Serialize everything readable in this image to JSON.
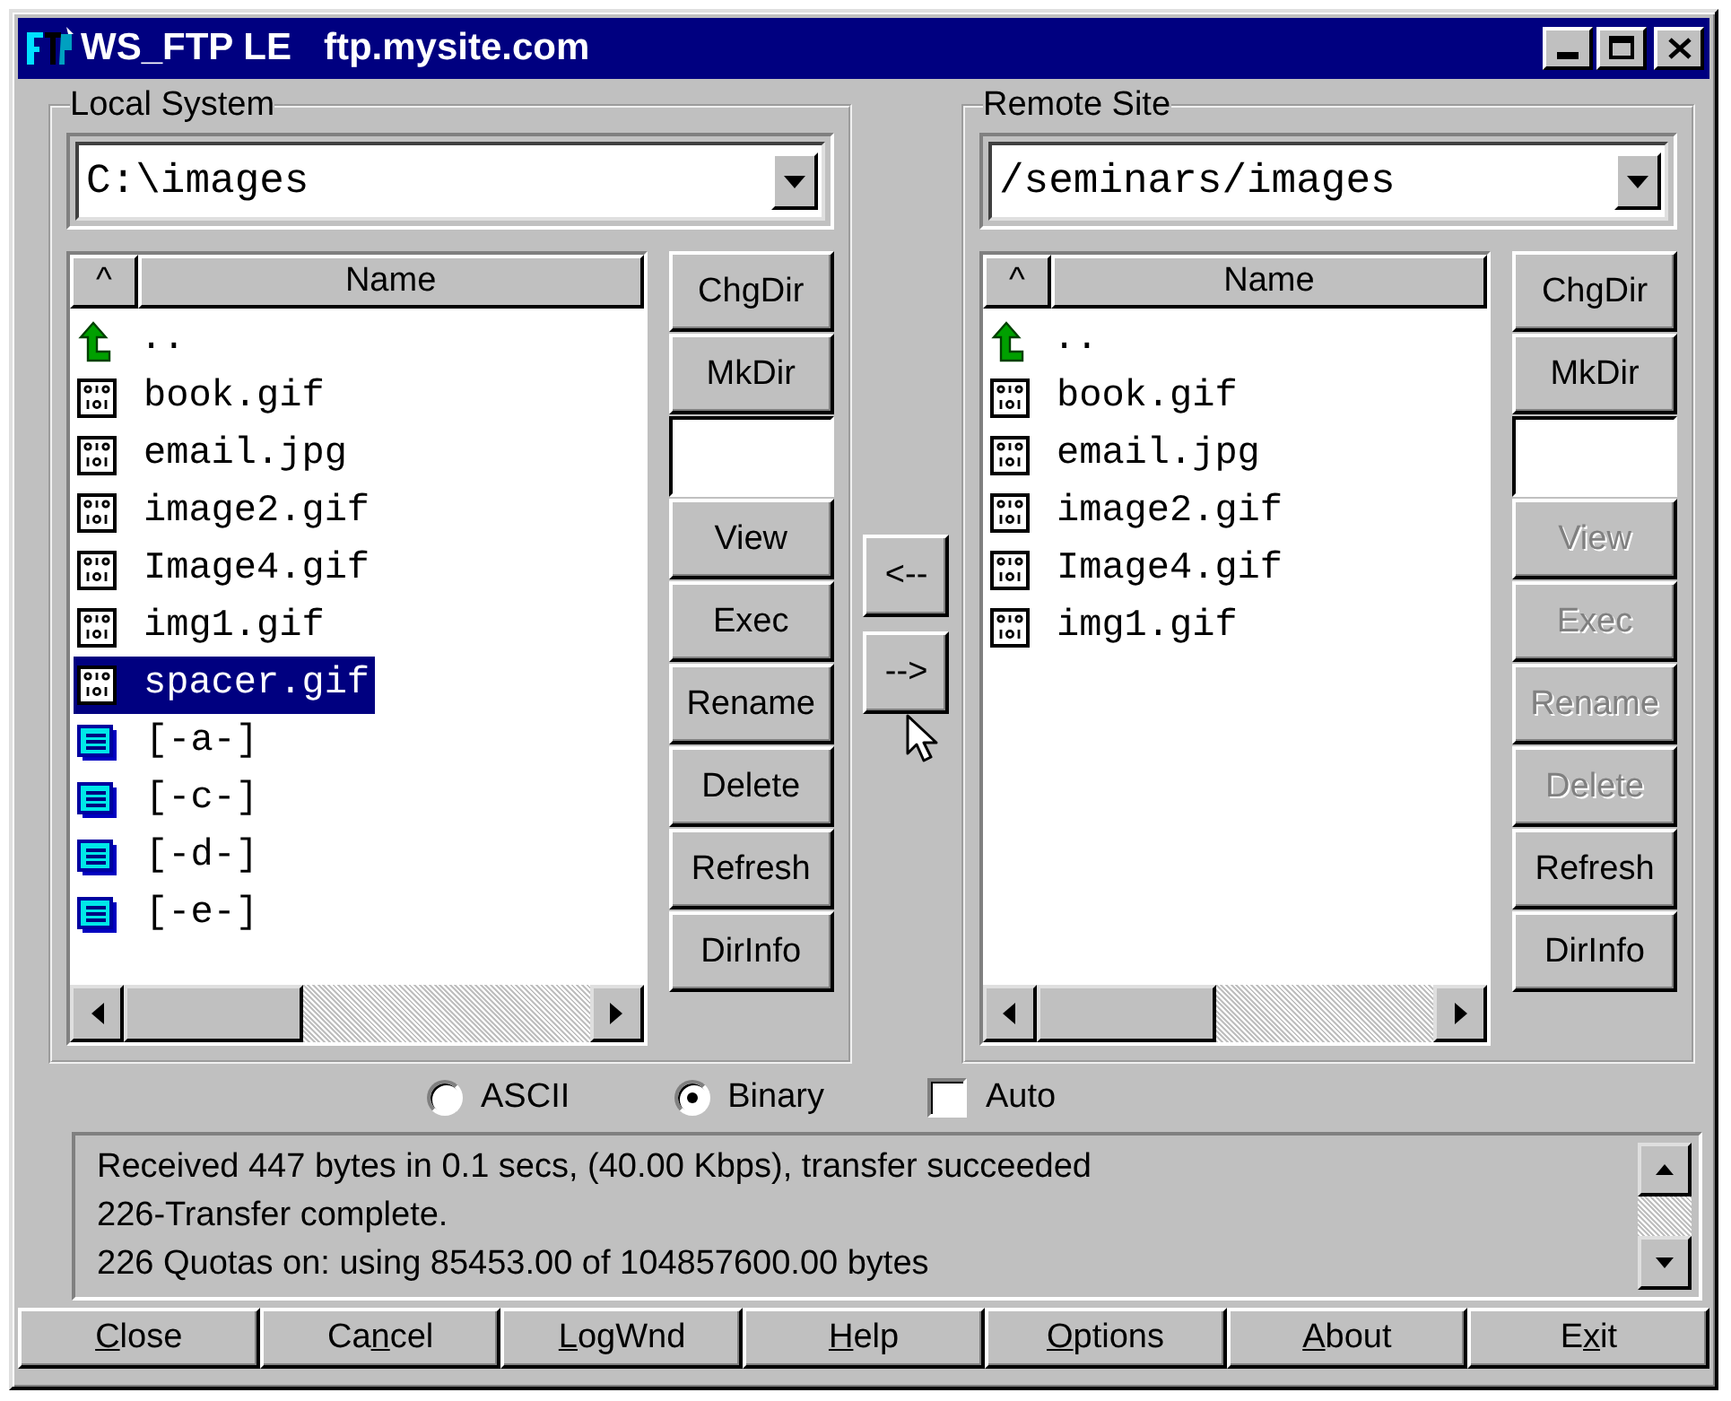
{
  "window": {
    "app": "WS_FTP LE",
    "host": "ftp.mysite.com"
  },
  "panels": [
    {
      "label": "Local System",
      "path": "C:\\images",
      "sort_button": "^",
      "column": "Name",
      "items": [
        {
          "kind": "up",
          "name": "..",
          "selected": false
        },
        {
          "kind": "file",
          "name": "book.gif",
          "selected": false
        },
        {
          "kind": "file",
          "name": "email.jpg",
          "selected": false
        },
        {
          "kind": "file",
          "name": "image2.gif",
          "selected": false
        },
        {
          "kind": "file",
          "name": "Image4.gif",
          "selected": false
        },
        {
          "kind": "file",
          "name": "img1.gif",
          "selected": false
        },
        {
          "kind": "file",
          "name": "spacer.gif",
          "selected": true
        },
        {
          "kind": "drive",
          "name": "[-a-]",
          "selected": false
        },
        {
          "kind": "drive",
          "name": "[-c-]",
          "selected": false
        },
        {
          "kind": "drive",
          "name": "[-d-]",
          "selected": false
        },
        {
          "kind": "drive",
          "name": "[-e-]",
          "selected": false
        }
      ],
      "buttons": [
        {
          "kind": "button",
          "label": "ChgDir",
          "disabled": false
        },
        {
          "kind": "button",
          "label": "MkDir",
          "disabled": false
        },
        {
          "kind": "field"
        },
        {
          "kind": "button",
          "label": "View",
          "disabled": false
        },
        {
          "kind": "button",
          "label": "Exec",
          "disabled": false
        },
        {
          "kind": "button",
          "label": "Rename",
          "disabled": false
        },
        {
          "kind": "button",
          "label": "Delete",
          "disabled": false
        },
        {
          "kind": "button",
          "label": "Refresh",
          "disabled": false
        },
        {
          "kind": "button",
          "label": "DirInfo",
          "disabled": false
        }
      ]
    },
    {
      "label": "Remote Site",
      "path": "/seminars/images",
      "sort_button": "^",
      "column": "Name",
      "items": [
        {
          "kind": "up",
          "name": "..",
          "selected": false
        },
        {
          "kind": "file",
          "name": "book.gif",
          "selected": false
        },
        {
          "kind": "file",
          "name": "email.jpg",
          "selected": false
        },
        {
          "kind": "file",
          "name": "image2.gif",
          "selected": false
        },
        {
          "kind": "file",
          "name": "Image4.gif",
          "selected": false
        },
        {
          "kind": "file",
          "name": "img1.gif",
          "selected": false
        }
      ],
      "buttons": [
        {
          "kind": "button",
          "label": "ChgDir",
          "disabled": false
        },
        {
          "kind": "button",
          "label": "MkDir",
          "disabled": false
        },
        {
          "kind": "field"
        },
        {
          "kind": "button",
          "label": "View",
          "disabled": true
        },
        {
          "kind": "button",
          "label": "Exec",
          "disabled": true
        },
        {
          "kind": "button",
          "label": "Rename",
          "disabled": true
        },
        {
          "kind": "button",
          "label": "Delete",
          "disabled": true
        },
        {
          "kind": "button",
          "label": "Refresh",
          "disabled": false
        },
        {
          "kind": "button",
          "label": "DirInfo",
          "disabled": false
        }
      ]
    }
  ],
  "transfer_buttons": [
    "<--",
    "-->"
  ],
  "modes": [
    {
      "kind": "radio",
      "label": "ASCII",
      "selected": false
    },
    {
      "kind": "radio",
      "label": "Binary",
      "selected": true
    },
    {
      "kind": "checkbox",
      "label": "Auto",
      "checked": false
    }
  ],
  "log": [
    "Received 447 bytes in 0.1 secs, (40.00 Kbps), transfer succeeded",
    "226-Transfer complete.",
    "226 Quotas on: using 85453.00 of 104857600.00 bytes"
  ],
  "bottom_buttons": [
    {
      "key": "C",
      "post": "lose"
    },
    {
      "pre": "Ca",
      "key": "n",
      "post": "cel"
    },
    {
      "key": "L",
      "post": "ogWnd"
    },
    {
      "key": "H",
      "post": "elp"
    },
    {
      "key": "O",
      "post": "ptions"
    },
    {
      "key": "A",
      "post": "bout"
    },
    {
      "pre": "E",
      "key": "x",
      "post": "it"
    }
  ]
}
